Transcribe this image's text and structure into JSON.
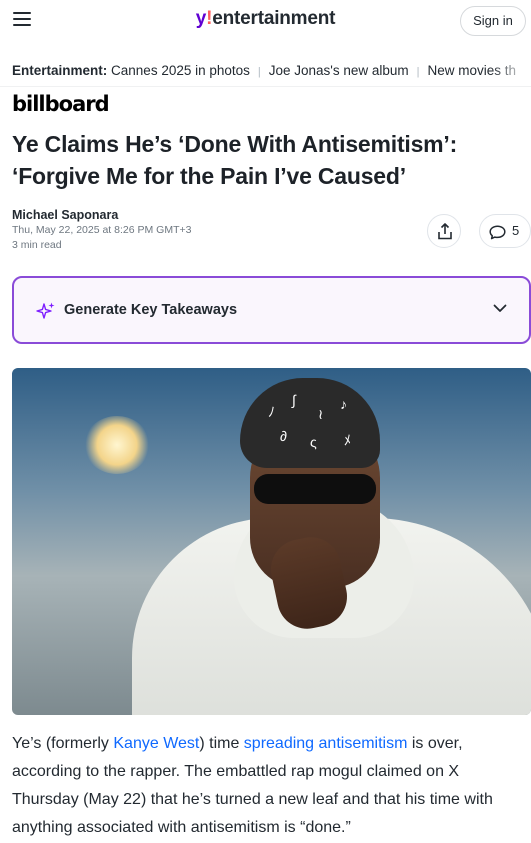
{
  "header": {
    "logo_y": "y",
    "logo_bang": "!",
    "logo_text": "entertainment",
    "signin_label": "Sign in",
    "menu_icon": "hamburger-menu-icon"
  },
  "trending": {
    "lead": "Entertainment:",
    "items": [
      "Cannes 2025 in photos",
      "Joe Jonas's new album",
      "New movies th"
    ]
  },
  "publisher": "billboard",
  "headline": "Ye Claims He’s ‘Done With Antisemitism’: ‘Forgive Me for the Pain I’ve Caused’",
  "byline": {
    "author": "Michael Saponara",
    "date": "Thu, May 22, 2025 at 8:26 PM GMT+3",
    "read_time": "3 min read"
  },
  "actions": {
    "share_icon": "share-icon",
    "comments_icon": "comment-icon",
    "comments_count": "5"
  },
  "takeaways": {
    "label": "Generate Key Takeaways",
    "icon": "sparkle-icon",
    "chevron": "chevron-down-icon"
  },
  "article": {
    "p1_before_link1": "Ye’s (formerly ",
    "link1": "Kanye West",
    "p1_between": ") time ",
    "link2": "spreading antisemitism",
    "p1_after": " is over, according to the rapper. The embattled rap mogul claimed on X Thursday (May 22) that he’s turned a new leaf and that his time with anything associated with antisemitism is “done.”"
  },
  "colors": {
    "brand_purple": "#6001d2",
    "takeaways_border": "#8a4bd8",
    "link_blue": "#0f69ff"
  }
}
